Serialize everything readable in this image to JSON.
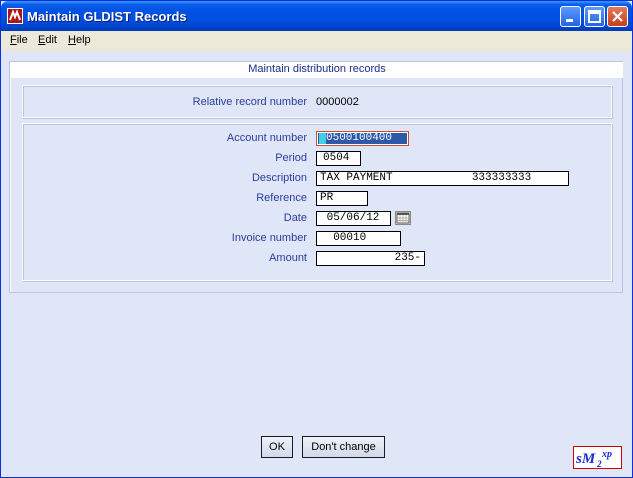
{
  "window": {
    "title": "Maintain GLDIST Records"
  },
  "menu": {
    "items": [
      {
        "first": "F",
        "rest": "ile"
      },
      {
        "first": "E",
        "rest": "dit"
      },
      {
        "first": "H",
        "rest": "elp"
      }
    ]
  },
  "panel": {
    "heading": "Maintain distribution records"
  },
  "record": {
    "label": "Relative record number",
    "value": "0000002"
  },
  "fields": {
    "account_label": "Account number",
    "account_value": "0500100400",
    "period_label": "Period",
    "period_value": "0504",
    "description_label": "Description",
    "description_value": "TAX PAYMENT            333333333",
    "reference_label": "Reference",
    "reference_value": "PR",
    "date_label": "Date",
    "date_value": " 05/06/12",
    "invoice_label": "Invoice number",
    "invoice_value": "  00010",
    "amount_label": "Amount",
    "amount_value": "235-"
  },
  "buttons": {
    "ok": "OK",
    "dont_change": "Don't change"
  },
  "logo": {
    "text_main": "sM",
    "text_sub": "2",
    "text_sup": "xp"
  },
  "colors": {
    "title_bar": "#0053e3",
    "label_text": "#2b3d9e",
    "background": "#dfe6f7"
  }
}
